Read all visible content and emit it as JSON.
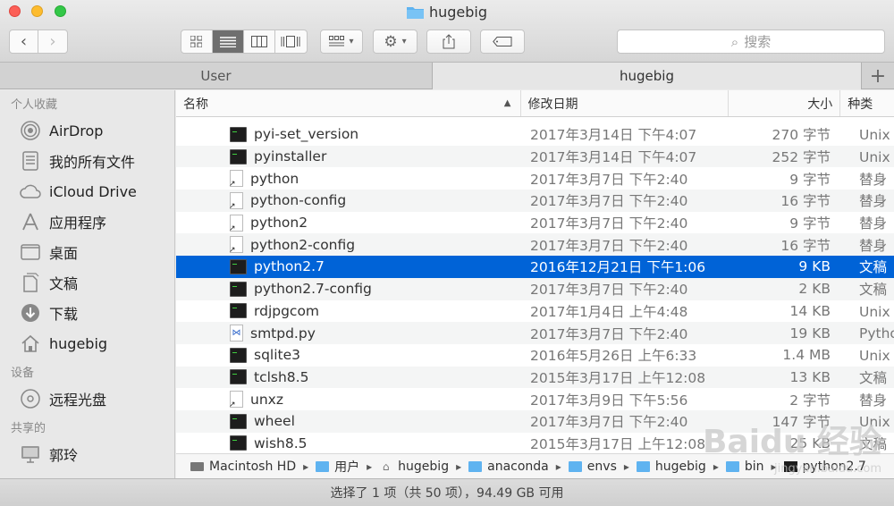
{
  "window": {
    "title": "hugebig"
  },
  "toolbar": {
    "back_icon": "chevron-left-icon",
    "forward_icon": "chevron-right-icon",
    "view_modes": [
      "icon-view",
      "list-view",
      "column-view",
      "coverflow-view"
    ],
    "active_view": "list-view",
    "search_placeholder": "搜索"
  },
  "tabs": [
    {
      "label": "User",
      "active": false
    },
    {
      "label": "hugebig",
      "active": true
    }
  ],
  "sidebar": {
    "sections": [
      {
        "title": "个人收藏",
        "items": [
          {
            "label": "AirDrop",
            "icon": "airdrop-icon"
          },
          {
            "label": "我的所有文件",
            "icon": "all-files-icon"
          },
          {
            "label": "iCloud Drive",
            "icon": "cloud-icon"
          },
          {
            "label": "应用程序",
            "icon": "applications-icon"
          },
          {
            "label": "桌面",
            "icon": "desktop-icon"
          },
          {
            "label": "文稿",
            "icon": "documents-icon"
          },
          {
            "label": "下载",
            "icon": "download-icon"
          },
          {
            "label": "hugebig",
            "icon": "home-icon"
          }
        ]
      },
      {
        "title": "设备",
        "items": [
          {
            "label": "远程光盘",
            "icon": "disc-icon"
          }
        ]
      },
      {
        "title": "共享的",
        "items": [
          {
            "label": "郭玲",
            "icon": "computer-icon"
          }
        ]
      }
    ]
  },
  "columns": {
    "name": "名称",
    "date": "修改日期",
    "size": "大小",
    "kind": "种类"
  },
  "files": [
    {
      "name": "pyi-set_version",
      "date": "2017年3月14日 下午4:07",
      "size": "270 字节",
      "kind": "Unix 可执行文件",
      "icon": "exec"
    },
    {
      "name": "pyinstaller",
      "date": "2017年3月14日 下午4:07",
      "size": "252 字节",
      "kind": "Unix 可执行文件",
      "icon": "exec"
    },
    {
      "name": "python",
      "date": "2017年3月7日 下午2:40",
      "size": "9 字节",
      "kind": "替身",
      "icon": "alias"
    },
    {
      "name": "python-config",
      "date": "2017年3月7日 下午2:40",
      "size": "16 字节",
      "kind": "替身",
      "icon": "alias"
    },
    {
      "name": "python2",
      "date": "2017年3月7日 下午2:40",
      "size": "9 字节",
      "kind": "替身",
      "icon": "alias"
    },
    {
      "name": "python2-config",
      "date": "2017年3月7日 下午2:40",
      "size": "16 字节",
      "kind": "替身",
      "icon": "alias"
    },
    {
      "name": "python2.7",
      "date": "2016年12月21日 下午1:06",
      "size": "9 KB",
      "kind": "文稿",
      "icon": "exec",
      "selected": true
    },
    {
      "name": "python2.7-config",
      "date": "2017年3月7日 下午2:40",
      "size": "2 KB",
      "kind": "文稿",
      "icon": "exec"
    },
    {
      "name": "rdjpgcom",
      "date": "2017年1月4日 上午4:48",
      "size": "14 KB",
      "kind": "Unix 可执行文件",
      "icon": "exec"
    },
    {
      "name": "smtpd.py",
      "date": "2017年3月7日 下午2:40",
      "size": "19 KB",
      "kind": "Python",
      "icon": "doc"
    },
    {
      "name": "sqlite3",
      "date": "2016年5月26日 上午6:33",
      "size": "1.4 MB",
      "kind": "Unix 可执行文件",
      "icon": "exec"
    },
    {
      "name": "tclsh8.5",
      "date": "2015年3月17日 上午12:08",
      "size": "13 KB",
      "kind": "文稿",
      "icon": "exec"
    },
    {
      "name": "unxz",
      "date": "2017年3月9日 下午5:56",
      "size": "2 字节",
      "kind": "替身",
      "icon": "alias"
    },
    {
      "name": "wheel",
      "date": "2017年3月7日 下午2:40",
      "size": "147 字节",
      "kind": "Unix 可执行文件",
      "icon": "exec"
    },
    {
      "name": "wish8.5",
      "date": "2015年3月17日 上午12:08",
      "size": "25 KB",
      "kind": "文稿",
      "icon": "exec"
    }
  ],
  "pathbar": [
    "Macintosh HD",
    "用户",
    "hugebig",
    "anaconda",
    "envs",
    "hugebig",
    "bin",
    "python2.7"
  ],
  "status": "选择了 1 项（共 50 项），94.49 GB 可用",
  "watermark": {
    "brand": "Baidu 经验",
    "url": "jingyan.baidu.com"
  },
  "colors": {
    "selection": "#0063d7",
    "folder": "#5fb3f0"
  }
}
